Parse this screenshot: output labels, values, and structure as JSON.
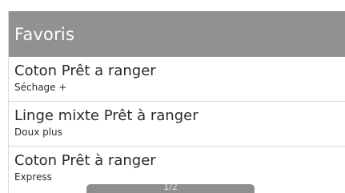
{
  "header": {
    "title": "Favoris"
  },
  "items": [
    {
      "title": "Coton Prêt a ranger",
      "subtitle": "Séchage +"
    },
    {
      "title": "Linge mixte Prêt à ranger",
      "subtitle": "Doux plus"
    },
    {
      "title": "Coton Prêt à ranger",
      "subtitle": "Express"
    }
  ],
  "pager": {
    "label": "1/2"
  }
}
